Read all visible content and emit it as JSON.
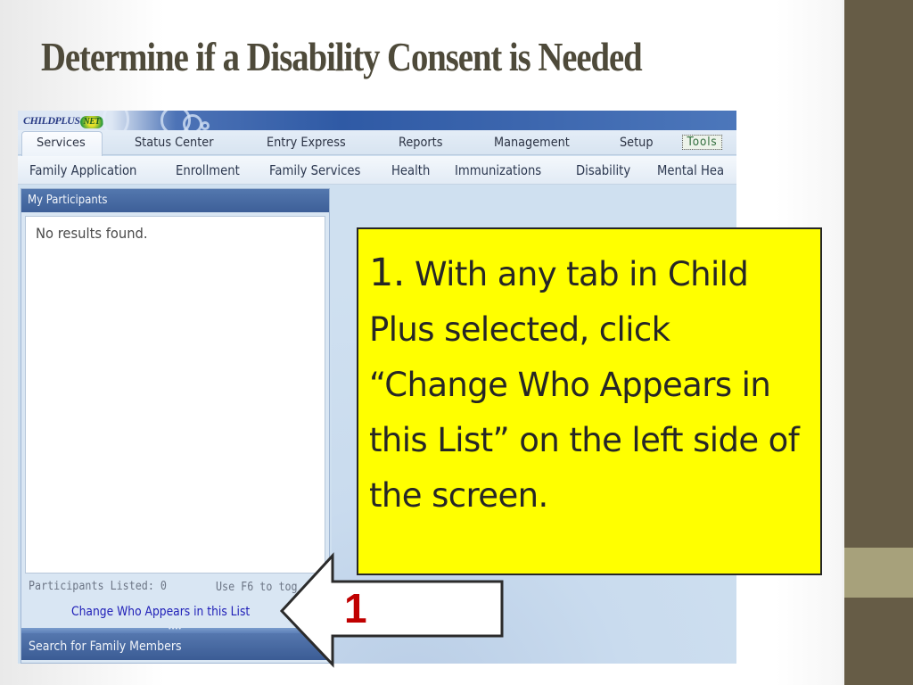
{
  "slide": {
    "title": "Determine if a Disability Consent is Needed",
    "colors": {
      "title": "#4e4a3a",
      "side_bar": "#665c46",
      "side_accent": "#a7a17b",
      "callout_bg": "#ffff00",
      "arrow_number": "#c00000"
    }
  },
  "app": {
    "logo": {
      "text": "CHILDPLUS",
      "badge": "NET"
    },
    "tabs": [
      {
        "label": "Services",
        "active": true
      },
      {
        "label": "Status Center",
        "active": false
      },
      {
        "label": "Entry Express",
        "active": false
      },
      {
        "label": "Reports",
        "active": false
      },
      {
        "label": "Management",
        "active": false
      },
      {
        "label": "Setup",
        "active": false
      },
      {
        "label": "Tools",
        "active": false
      }
    ],
    "subtabs": [
      {
        "label": "Family Application"
      },
      {
        "label": "Enrollment"
      },
      {
        "label": "Family Services"
      },
      {
        "label": "Health"
      },
      {
        "label": "Immunizations"
      },
      {
        "label": "Disability"
      },
      {
        "label": "Mental Hea"
      }
    ],
    "participants_panel": {
      "header": "My Participants",
      "empty_message": "No results found.",
      "count_label": "Participants Listed: 0",
      "hint": "Use F6 to tog",
      "change_link": "Change Who Appears in this List",
      "splitter_grip": "••••"
    },
    "search_panel": {
      "header": "Search for Family Members"
    }
  },
  "callout": {
    "number": "1.",
    "text": "With any tab in Child Plus selected, click “Change Who Appears in this List” on the left side of the screen."
  },
  "arrow": {
    "label": "1",
    "direction": "left"
  }
}
